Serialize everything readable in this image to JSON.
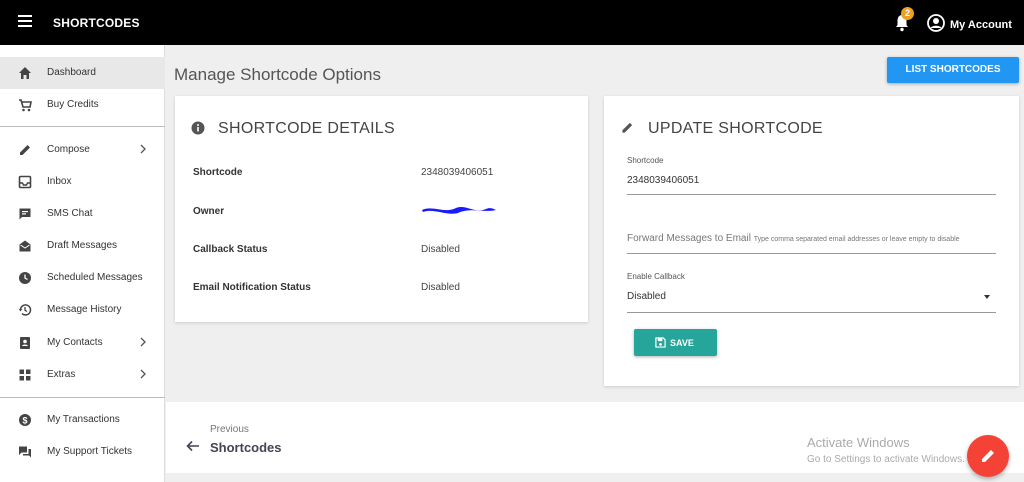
{
  "header": {
    "brand": "SHORTCODES",
    "notification_count": "2",
    "account_label": "My Account"
  },
  "sidebar": {
    "items": [
      {
        "label": "Dashboard",
        "icon": "home-icon",
        "active": true
      },
      {
        "label": "Buy Credits",
        "icon": "cart-icon"
      },
      {
        "label": "Compose",
        "icon": "pencil-icon",
        "has_submenu": true
      },
      {
        "label": "Inbox",
        "icon": "inbox-icon"
      },
      {
        "label": "SMS Chat",
        "icon": "chat-icon"
      },
      {
        "label": "Draft Messages",
        "icon": "drafts-icon"
      },
      {
        "label": "Scheduled Messages",
        "icon": "clock-icon"
      },
      {
        "label": "Message History",
        "icon": "history-icon"
      },
      {
        "label": "My Contacts",
        "icon": "contacts-icon",
        "has_submenu": true
      },
      {
        "label": "Extras",
        "icon": "grid-icon",
        "has_submenu": true
      },
      {
        "label": "My Transactions",
        "icon": "dollar-icon"
      },
      {
        "label": "My Support Tickets",
        "icon": "forum-icon"
      }
    ]
  },
  "main": {
    "title": "Manage Shortcode Options",
    "list_button": "LIST SHORTCODES"
  },
  "details": {
    "title": "SHORTCODE DETAILS",
    "rows": [
      {
        "label": "Shortcode",
        "value": "2348039406051"
      },
      {
        "label": "Owner",
        "value": ""
      },
      {
        "label": "Callback Status",
        "value": "Disabled"
      },
      {
        "label": "Email Notification Status",
        "value": "Disabled"
      }
    ]
  },
  "update": {
    "title": "UPDATE SHORTCODE",
    "shortcode_label": "Shortcode",
    "shortcode_value": "2348039406051",
    "forward_label": "Forward Messages to Email",
    "forward_hint": "Type comma separated email addresses or leave empty to disable",
    "callback_label": "Enable Callback",
    "callback_value": "Disabled",
    "save_label": "SAVE"
  },
  "footer": {
    "previous_label": "Previous",
    "previous_title": "Shortcodes"
  },
  "watermark": {
    "line1": "Activate Windows",
    "line2": "Go to Settings to activate Windows."
  },
  "colors": {
    "topbar": "#000000",
    "accent_blue": "#2196f3",
    "save_teal": "#26a69a",
    "fab_red": "#f44336",
    "badge_orange": "#f0a020"
  }
}
